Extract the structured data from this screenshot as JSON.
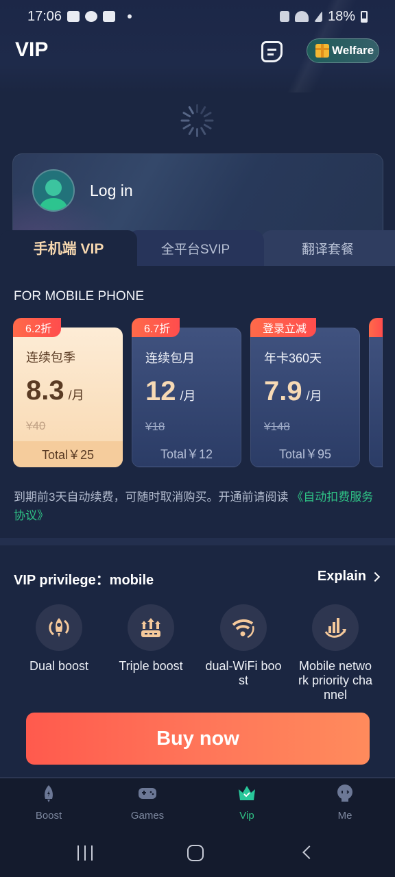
{
  "status_bar": {
    "time": "17:06",
    "battery": "18%",
    "left_icons": [
      "gallery-icon",
      "cloud-icon",
      "bus-icon",
      "dot-icon"
    ],
    "right_icons": [
      "mute-icon",
      "wifi-icon",
      "signal-icon",
      "battery-icon"
    ]
  },
  "header": {
    "title": "VIP",
    "notes_icon": "notes-icon",
    "welfare_label": "Welfare",
    "welfare_icon": "gift-icon"
  },
  "loading": {
    "icon": "spinner-icon"
  },
  "login": {
    "label": "Log in",
    "avatar_icon": "user-avatar-icon"
  },
  "tabs": [
    {
      "label": "手机端 VIP",
      "active": true
    },
    {
      "label": "全平台SVIP",
      "active": false
    },
    {
      "label": "翻译套餐",
      "active": false
    }
  ],
  "section_title": "FOR MOBILE PHONE",
  "plans": [
    {
      "badge": "6.2折",
      "name": "连续包季",
      "price": "8.3",
      "unit": "/月",
      "original": "¥40",
      "total": "Total￥25",
      "selected": true
    },
    {
      "badge": "6.7折",
      "name": "连续包月",
      "price": "12",
      "unit": "/月",
      "original": "¥18",
      "total": "Total￥12",
      "selected": false
    },
    {
      "badge": "登录立减",
      "name": "年卡360天",
      "price": "7.9",
      "unit": "/月",
      "original": "¥148",
      "total": "Total￥95",
      "selected": false
    }
  ],
  "notice": {
    "text": "到期前3天自动续费，可随时取消购买。开通前请阅读",
    "link": "《自动扣费服务协议》"
  },
  "privilege": {
    "title": "VIP privilege：mobile",
    "explain": "Explain",
    "items": [
      {
        "label": "Dual boost",
        "icon": "rocket-boost-icon"
      },
      {
        "label": "Triple boost",
        "icon": "triple-arrows-icon"
      },
      {
        "label": "dual-WiFi boost",
        "icon": "wifi-boost-icon"
      },
      {
        "label": "Mobile network priority channel",
        "icon": "signal-bars-icon"
      }
    ]
  },
  "buy_button": "Buy now",
  "bottom_nav": [
    {
      "label": "Boost",
      "icon": "rocket-icon",
      "active": false
    },
    {
      "label": "Games",
      "icon": "gamepad-icon",
      "active": false
    },
    {
      "label": "Vip",
      "icon": "crown-icon",
      "active": true
    },
    {
      "label": "Me",
      "icon": "face-icon",
      "active": false
    }
  ],
  "colors": {
    "background": "#1b2641",
    "accent_green": "#2fc386",
    "buy_gradient_start": "#ff5a4d",
    "buy_gradient_end": "#ff8b5c",
    "gold_text": "#f7dab5"
  }
}
